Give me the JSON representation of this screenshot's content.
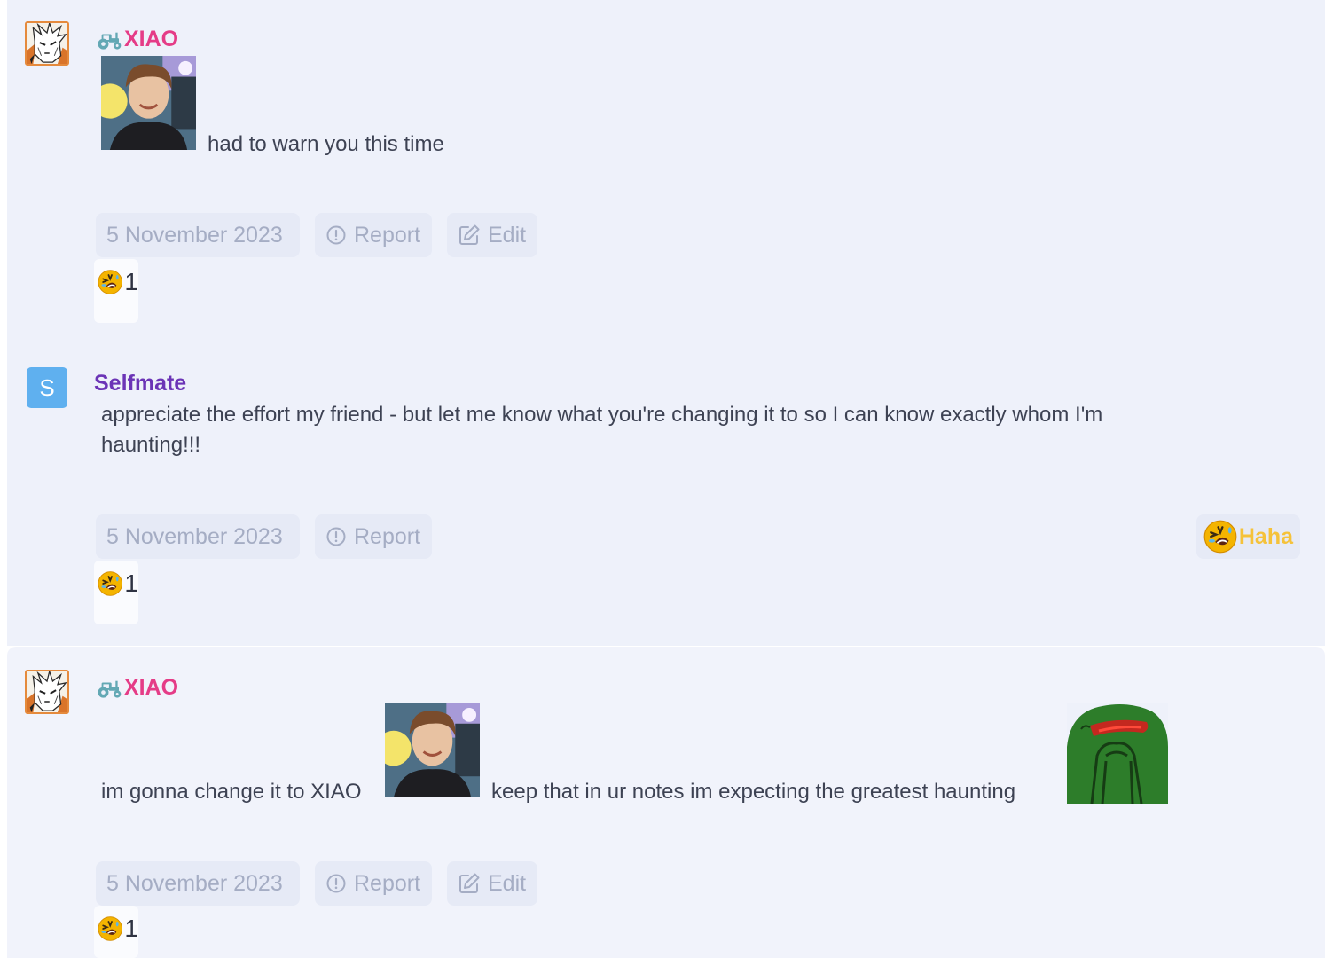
{
  "posts": [
    {
      "username": "XIAO",
      "text": "had to warn you this time",
      "date": "5 November 2023",
      "report_label": "Report",
      "edit_label": "Edit",
      "reaction_count": "1"
    },
    {
      "avatar_letter": "S",
      "username": "Selfmate",
      "text_line1": "appreciate the effort my friend - but let me know what you're changing it to so I can know exactly whom I'm",
      "text_line2": "haunting!!!",
      "date": "5 November 2023",
      "report_label": "Report",
      "haha_label": "Haha",
      "reaction_count": "1"
    },
    {
      "username": "XIAO",
      "text_part1": "im gonna change it to XIAO",
      "text_part2": "keep that in ur notes im expecting the greatest haunting",
      "date": "5 November 2023",
      "report_label": "Report",
      "edit_label": "Edit",
      "reaction_count": "1"
    }
  ],
  "colors": {
    "xiao_name": "#e53c87",
    "selfmate_name": "#6b34b6",
    "tractor_icon": "#63a8b4",
    "meta_text": "#a5adc4",
    "haha": "#f5c23a"
  },
  "icons": [
    "tractor-icon",
    "report-icon",
    "edit-icon",
    "laughing-emoji-icon"
  ]
}
